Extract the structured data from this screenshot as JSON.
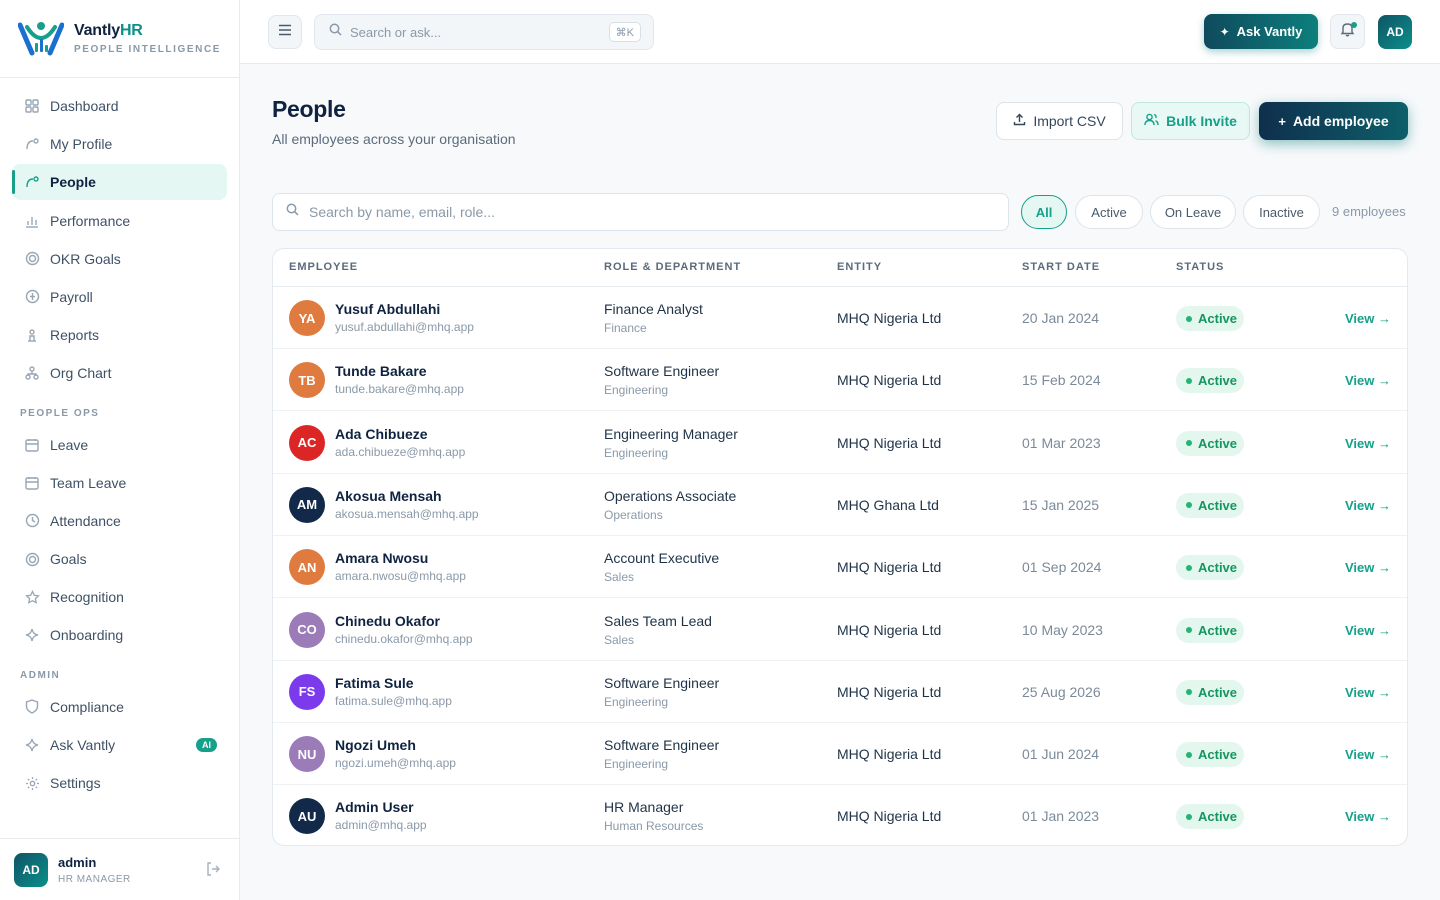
{
  "brand": {
    "name_main": "Vantly",
    "name_accent": "HR",
    "subtitle": "PEOPLE INTELLIGENCE"
  },
  "colors": {
    "accent": "#16a08a",
    "navy": "#0f2340",
    "status_active": "#17955f"
  },
  "nav": {
    "main_items": [
      {
        "label": "Dashboard",
        "icon": "grid-icon"
      },
      {
        "label": "My Profile",
        "icon": "profile-icon"
      },
      {
        "label": "People",
        "icon": "people-icon",
        "active": true
      },
      {
        "label": "Performance",
        "icon": "bar-chart-icon"
      },
      {
        "label": "OKR Goals",
        "icon": "target-icon"
      },
      {
        "label": "Payroll",
        "icon": "payroll-icon"
      },
      {
        "label": "Reports",
        "icon": "reports-icon"
      },
      {
        "label": "Org Chart",
        "icon": "org-chart-icon"
      }
    ],
    "people_ops_title": "PEOPLE OPS",
    "people_ops_items": [
      {
        "label": "Leave",
        "icon": "calendar-icon"
      },
      {
        "label": "Team Leave",
        "icon": "calendar-icon"
      },
      {
        "label": "Attendance",
        "icon": "clock-icon"
      },
      {
        "label": "Goals",
        "icon": "target-icon"
      },
      {
        "label": "Recognition",
        "icon": "star-icon"
      },
      {
        "label": "Onboarding",
        "icon": "sparkle-icon"
      }
    ],
    "admin_title": "ADMIN",
    "admin_items": [
      {
        "label": "Compliance",
        "icon": "shield-icon"
      },
      {
        "label": "Ask Vantly",
        "icon": "sparkle-icon",
        "badge": "AI"
      },
      {
        "label": "Settings",
        "icon": "gear-icon"
      }
    ]
  },
  "user": {
    "initials": "AD",
    "name": "admin",
    "role": "HR MANAGER"
  },
  "topbar": {
    "search_placeholder": "Search or ask...",
    "shortcut": "⌘K",
    "ask_label": "Ask Vantly",
    "avatar": "AD"
  },
  "page": {
    "title": "People",
    "subtitle": "All employees across your organisation",
    "import_label": "Import CSV",
    "bulk_label": "Bulk Invite",
    "add_label": "Add employee",
    "search_placeholder": "Search by name, email, role...",
    "filters": [
      "All",
      "Active",
      "On Leave",
      "Inactive"
    ],
    "active_filter": "All",
    "count_label": "9 employees"
  },
  "table": {
    "headers": {
      "employee": "EMPLOYEE",
      "role": "ROLE & DEPARTMENT",
      "entity": "ENTITY",
      "start": "START DATE",
      "status": "STATUS"
    },
    "view_label": "View →",
    "rows": [
      {
        "initials": "YA",
        "color": "#e07b3f",
        "name": "Yusuf Abdullahi",
        "email": "yusuf.abdullahi@mhq.app",
        "role": "Finance Analyst",
        "dept": "Finance",
        "entity": "MHQ Nigeria Ltd",
        "start": "20 Jan 2024",
        "status": "Active"
      },
      {
        "initials": "TB",
        "color": "#e07b3f",
        "name": "Tunde Bakare",
        "email": "tunde.bakare@mhq.app",
        "role": "Software Engineer",
        "dept": "Engineering",
        "entity": "MHQ Nigeria Ltd",
        "start": "15 Feb 2024",
        "status": "Active"
      },
      {
        "initials": "AC",
        "color": "#dc2626",
        "name": "Ada Chibueze",
        "email": "ada.chibueze@mhq.app",
        "role": "Engineering Manager",
        "dept": "Engineering",
        "entity": "MHQ Nigeria Ltd",
        "start": "01 Mar 2023",
        "status": "Active"
      },
      {
        "initials": "AM",
        "color": "#12294a",
        "name": "Akosua Mensah",
        "email": "akosua.mensah@mhq.app",
        "role": "Operations Associate",
        "dept": "Operations",
        "entity": "MHQ Ghana Ltd",
        "start": "15 Jan 2025",
        "status": "Active"
      },
      {
        "initials": "AN",
        "color": "#e07b3f",
        "name": "Amara Nwosu",
        "email": "amara.nwosu@mhq.app",
        "role": "Account Executive",
        "dept": "Sales",
        "entity": "MHQ Nigeria Ltd",
        "start": "01 Sep 2024",
        "status": "Active"
      },
      {
        "initials": "CO",
        "color": "#9b7bb8",
        "name": "Chinedu Okafor",
        "email": "chinedu.okafor@mhq.app",
        "role": "Sales Team Lead",
        "dept": "Sales",
        "entity": "MHQ Nigeria Ltd",
        "start": "10 May 2023",
        "status": "Active"
      },
      {
        "initials": "FS",
        "color": "#7c3aed",
        "name": "Fatima Sule",
        "email": "fatima.sule@mhq.app",
        "role": "Software Engineer",
        "dept": "Engineering",
        "entity": "MHQ Nigeria Ltd",
        "start": "25 Aug 2026",
        "status": "Active"
      },
      {
        "initials": "NU",
        "color": "#9b7bb8",
        "name": "Ngozi Umeh",
        "email": "ngozi.umeh@mhq.app",
        "role": "Software Engineer",
        "dept": "Engineering",
        "entity": "MHQ Nigeria Ltd",
        "start": "01 Jun 2024",
        "status": "Active"
      },
      {
        "initials": "AU",
        "color": "#12294a",
        "name": "Admin User",
        "email": "admin@mhq.app",
        "role": "HR Manager",
        "dept": "Human Resources",
        "entity": "MHQ Nigeria Ltd",
        "start": "01 Jan 2023",
        "status": "Active"
      }
    ]
  }
}
